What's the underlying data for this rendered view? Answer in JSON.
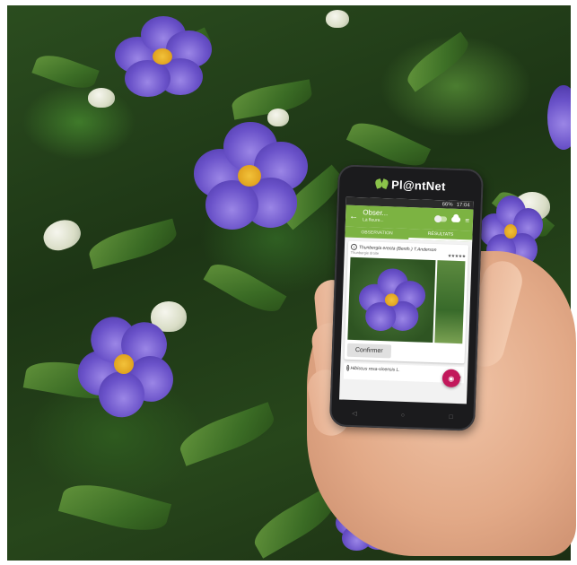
{
  "app": {
    "logo_text": "Pl@ntNet",
    "status_time": "17:04",
    "status_battery": "66%",
    "appbar_title": "Obser...",
    "appbar_subtitle": "La fleure...",
    "tabs": [
      {
        "label": "OBSERVATION",
        "active": false
      },
      {
        "label": "RÉSULTATS",
        "active": true
      }
    ],
    "results": [
      {
        "scientific_name": "Thunbergia erecta (Benth.) T.Anderson",
        "common_name": "Thunbergie droite",
        "stars": "★★★★★"
      },
      {
        "scientific_name": "Hibiscus rosa-sinensis L.",
        "stars": "★★★★"
      }
    ],
    "confirm_label": "Confirmer",
    "info_symbol": "i",
    "icons": {
      "back": "←",
      "filter": "≡",
      "camera": "◉",
      "nav_back": "◁",
      "nav_home": "○",
      "nav_recent": "□"
    }
  },
  "colors": {
    "appbar_green": "#7cb342",
    "fab_pink": "#c2185b",
    "flower_purple": "#6a52c9",
    "flower_center": "#f2c23a"
  }
}
